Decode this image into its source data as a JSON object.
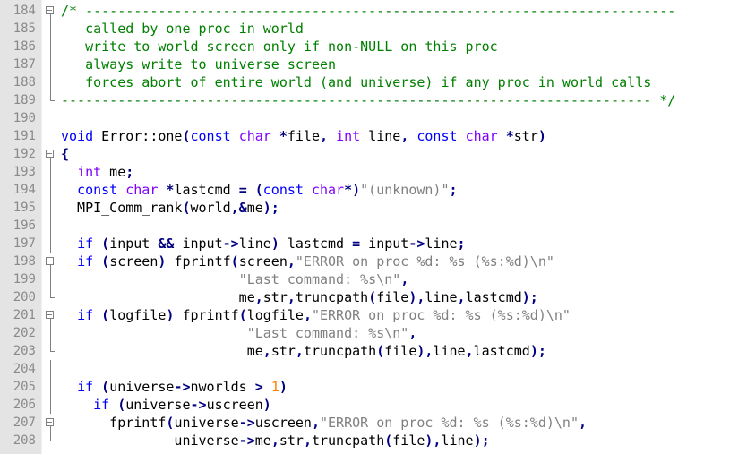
{
  "editor": {
    "lines": [
      {
        "num": "184",
        "fold": "box",
        "tokens": [
          {
            "t": "/* -------------------------------------------------------------------------",
            "c": "cm"
          }
        ]
      },
      {
        "num": "185",
        "fold": "bar",
        "tokens": [
          {
            "t": "   called by one proc in world",
            "c": "cm"
          }
        ]
      },
      {
        "num": "186",
        "fold": "bar",
        "tokens": [
          {
            "t": "   write to world screen only if non-NULL on this proc",
            "c": "cm"
          }
        ]
      },
      {
        "num": "187",
        "fold": "bar",
        "tokens": [
          {
            "t": "   always write to universe screen",
            "c": "cm"
          }
        ]
      },
      {
        "num": "188",
        "fold": "bar",
        "tokens": [
          {
            "t": "   forces abort of entire world (and universe) if any proc in world calls",
            "c": "cm"
          }
        ]
      },
      {
        "num": "189",
        "fold": "end",
        "tokens": [
          {
            "t": "------------------------------------------------------------------------- */",
            "c": "cm"
          }
        ]
      },
      {
        "num": "190",
        "fold": "",
        "tokens": []
      },
      {
        "num": "191",
        "fold": "",
        "tokens": [
          {
            "t": "void",
            "c": "kw"
          },
          {
            "t": " Error::one",
            "c": "tx"
          },
          {
            "t": "(",
            "c": "op"
          },
          {
            "t": "const",
            "c": "kw"
          },
          {
            "t": " ",
            "c": "tx"
          },
          {
            "t": "char",
            "c": "ty"
          },
          {
            "t": " ",
            "c": "tx"
          },
          {
            "t": "*",
            "c": "op"
          },
          {
            "t": "file",
            "c": "tx"
          },
          {
            "t": ",",
            "c": "op"
          },
          {
            "t": " ",
            "c": "tx"
          },
          {
            "t": "int",
            "c": "ty"
          },
          {
            "t": " line",
            "c": "tx"
          },
          {
            "t": ",",
            "c": "op"
          },
          {
            "t": " ",
            "c": "tx"
          },
          {
            "t": "const",
            "c": "kw"
          },
          {
            "t": " ",
            "c": "tx"
          },
          {
            "t": "char",
            "c": "ty"
          },
          {
            "t": " ",
            "c": "tx"
          },
          {
            "t": "*",
            "c": "op"
          },
          {
            "t": "str",
            "c": "tx"
          },
          {
            "t": ")",
            "c": "op"
          }
        ]
      },
      {
        "num": "192",
        "fold": "box",
        "tokens": [
          {
            "t": "{",
            "c": "op"
          }
        ]
      },
      {
        "num": "193",
        "fold": "bar",
        "tokens": [
          {
            "t": "  ",
            "c": "tx"
          },
          {
            "t": "int",
            "c": "ty"
          },
          {
            "t": " me",
            "c": "tx"
          },
          {
            "t": ";",
            "c": "op"
          }
        ]
      },
      {
        "num": "194",
        "fold": "bar",
        "tokens": [
          {
            "t": "  ",
            "c": "tx"
          },
          {
            "t": "const",
            "c": "kw"
          },
          {
            "t": " ",
            "c": "tx"
          },
          {
            "t": "char",
            "c": "ty"
          },
          {
            "t": " ",
            "c": "tx"
          },
          {
            "t": "*",
            "c": "op"
          },
          {
            "t": "lastcmd ",
            "c": "tx"
          },
          {
            "t": "=",
            "c": "op"
          },
          {
            "t": " ",
            "c": "tx"
          },
          {
            "t": "(",
            "c": "op"
          },
          {
            "t": "const",
            "c": "kw"
          },
          {
            "t": " ",
            "c": "tx"
          },
          {
            "t": "char",
            "c": "ty"
          },
          {
            "t": "*)",
            "c": "op"
          },
          {
            "t": "\"(unknown)\"",
            "c": "st"
          },
          {
            "t": ";",
            "c": "op"
          }
        ]
      },
      {
        "num": "195",
        "fold": "bar",
        "tokens": [
          {
            "t": "  MPI_Comm_rank",
            "c": "tx"
          },
          {
            "t": "(",
            "c": "op"
          },
          {
            "t": "world",
            "c": "tx"
          },
          {
            "t": ",&",
            "c": "op"
          },
          {
            "t": "me",
            "c": "tx"
          },
          {
            "t": ");",
            "c": "op"
          }
        ]
      },
      {
        "num": "196",
        "fold": "bar",
        "tokens": []
      },
      {
        "num": "197",
        "fold": "bar",
        "tokens": [
          {
            "t": "  ",
            "c": "tx"
          },
          {
            "t": "if",
            "c": "kw"
          },
          {
            "t": " ",
            "c": "tx"
          },
          {
            "t": "(",
            "c": "op"
          },
          {
            "t": "input ",
            "c": "tx"
          },
          {
            "t": "&&",
            "c": "op"
          },
          {
            "t": " input",
            "c": "tx"
          },
          {
            "t": "->",
            "c": "op"
          },
          {
            "t": "line",
            "c": "tx"
          },
          {
            "t": ")",
            "c": "op"
          },
          {
            "t": " lastcmd ",
            "c": "tx"
          },
          {
            "t": "=",
            "c": "op"
          },
          {
            "t": " input",
            "c": "tx"
          },
          {
            "t": "->",
            "c": "op"
          },
          {
            "t": "line",
            "c": "tx"
          },
          {
            "t": ";",
            "c": "op"
          }
        ]
      },
      {
        "num": "198",
        "fold": "box",
        "tokens": [
          {
            "t": "  ",
            "c": "tx"
          },
          {
            "t": "if",
            "c": "kw"
          },
          {
            "t": " ",
            "c": "tx"
          },
          {
            "t": "(",
            "c": "op"
          },
          {
            "t": "screen",
            "c": "tx"
          },
          {
            "t": ")",
            "c": "op"
          },
          {
            "t": " fprintf",
            "c": "tx"
          },
          {
            "t": "(",
            "c": "op"
          },
          {
            "t": "screen",
            "c": "tx"
          },
          {
            "t": ",",
            "c": "op"
          },
          {
            "t": "\"ERROR on proc %d: %s (%s:%d)\\n\"",
            "c": "st"
          }
        ]
      },
      {
        "num": "199",
        "fold": "bar",
        "tokens": [
          {
            "t": "                      ",
            "c": "tx"
          },
          {
            "t": "\"Last command: %s\\n\"",
            "c": "st"
          },
          {
            "t": ",",
            "c": "op"
          }
        ]
      },
      {
        "num": "200",
        "fold": "end",
        "tokens": [
          {
            "t": "                      me",
            "c": "tx"
          },
          {
            "t": ",",
            "c": "op"
          },
          {
            "t": "str",
            "c": "tx"
          },
          {
            "t": ",",
            "c": "op"
          },
          {
            "t": "truncpath",
            "c": "tx"
          },
          {
            "t": "(",
            "c": "op"
          },
          {
            "t": "file",
            "c": "tx"
          },
          {
            "t": "),",
            "c": "op"
          },
          {
            "t": "line",
            "c": "tx"
          },
          {
            "t": ",",
            "c": "op"
          },
          {
            "t": "lastcmd",
            "c": "tx"
          },
          {
            "t": ");",
            "c": "op"
          }
        ]
      },
      {
        "num": "201",
        "fold": "box",
        "tokens": [
          {
            "t": "  ",
            "c": "tx"
          },
          {
            "t": "if",
            "c": "kw"
          },
          {
            "t": " ",
            "c": "tx"
          },
          {
            "t": "(",
            "c": "op"
          },
          {
            "t": "logfile",
            "c": "tx"
          },
          {
            "t": ")",
            "c": "op"
          },
          {
            "t": " fprintf",
            "c": "tx"
          },
          {
            "t": "(",
            "c": "op"
          },
          {
            "t": "logfile",
            "c": "tx"
          },
          {
            "t": ",",
            "c": "op"
          },
          {
            "t": "\"ERROR on proc %d: %s (%s:%d)\\n\"",
            "c": "st"
          }
        ]
      },
      {
        "num": "202",
        "fold": "bar",
        "tokens": [
          {
            "t": "                       ",
            "c": "tx"
          },
          {
            "t": "\"Last command: %s\\n\"",
            "c": "st"
          },
          {
            "t": ",",
            "c": "op"
          }
        ]
      },
      {
        "num": "203",
        "fold": "end",
        "tokens": [
          {
            "t": "                       me",
            "c": "tx"
          },
          {
            "t": ",",
            "c": "op"
          },
          {
            "t": "str",
            "c": "tx"
          },
          {
            "t": ",",
            "c": "op"
          },
          {
            "t": "truncpath",
            "c": "tx"
          },
          {
            "t": "(",
            "c": "op"
          },
          {
            "t": "file",
            "c": "tx"
          },
          {
            "t": "),",
            "c": "op"
          },
          {
            "t": "line",
            "c": "tx"
          },
          {
            "t": ",",
            "c": "op"
          },
          {
            "t": "lastcmd",
            "c": "tx"
          },
          {
            "t": ");",
            "c": "op"
          }
        ]
      },
      {
        "num": "204",
        "fold": "bar",
        "tokens": []
      },
      {
        "num": "205",
        "fold": "bar",
        "tokens": [
          {
            "t": "  ",
            "c": "tx"
          },
          {
            "t": "if",
            "c": "kw"
          },
          {
            "t": " ",
            "c": "tx"
          },
          {
            "t": "(",
            "c": "op"
          },
          {
            "t": "universe",
            "c": "tx"
          },
          {
            "t": "->",
            "c": "op"
          },
          {
            "t": "nworlds ",
            "c": "tx"
          },
          {
            "t": ">",
            "c": "op"
          },
          {
            "t": " ",
            "c": "tx"
          },
          {
            "t": "1",
            "c": "nu"
          },
          {
            "t": ")",
            "c": "op"
          }
        ]
      },
      {
        "num": "206",
        "fold": "bar",
        "tokens": [
          {
            "t": "    ",
            "c": "tx"
          },
          {
            "t": "if",
            "c": "kw"
          },
          {
            "t": " ",
            "c": "tx"
          },
          {
            "t": "(",
            "c": "op"
          },
          {
            "t": "universe",
            "c": "tx"
          },
          {
            "t": "->",
            "c": "op"
          },
          {
            "t": "uscreen",
            "c": "tx"
          },
          {
            "t": ")",
            "c": "op"
          }
        ]
      },
      {
        "num": "207",
        "fold": "box",
        "tokens": [
          {
            "t": "      fprintf",
            "c": "tx"
          },
          {
            "t": "(",
            "c": "op"
          },
          {
            "t": "universe",
            "c": "tx"
          },
          {
            "t": "->",
            "c": "op"
          },
          {
            "t": "uscreen",
            "c": "tx"
          },
          {
            "t": ",",
            "c": "op"
          },
          {
            "t": "\"ERROR on proc %d: %s (%s:%d)\\n\"",
            "c": "st"
          },
          {
            "t": ",",
            "c": "op"
          }
        ]
      },
      {
        "num": "208",
        "fold": "end",
        "tokens": [
          {
            "t": "              universe",
            "c": "tx"
          },
          {
            "t": "->",
            "c": "op"
          },
          {
            "t": "me",
            "c": "tx"
          },
          {
            "t": ",",
            "c": "op"
          },
          {
            "t": "str",
            "c": "tx"
          },
          {
            "t": ",",
            "c": "op"
          },
          {
            "t": "truncpath",
            "c": "tx"
          },
          {
            "t": "(",
            "c": "op"
          },
          {
            "t": "file",
            "c": "tx"
          },
          {
            "t": "),",
            "c": "op"
          },
          {
            "t": "line",
            "c": "tx"
          },
          {
            "t": ");",
            "c": "op"
          }
        ]
      }
    ],
    "colors": {
      "comment": "#008000",
      "keyword": "#0000ff",
      "type": "#8000ff",
      "operator": "#000080",
      "string": "#808080",
      "number": "#ff8000"
    }
  }
}
